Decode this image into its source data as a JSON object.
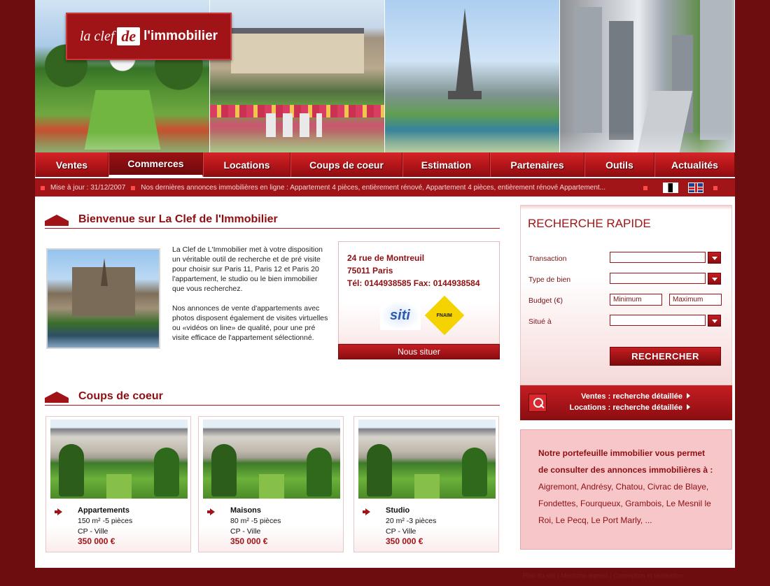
{
  "logo": {
    "la": "la clef",
    "de": "de",
    "imm": "l'immobilier"
  },
  "nav": {
    "items": [
      "Ventes",
      "Commerces",
      "Locations",
      "Coups de coeur",
      "Estimation",
      "Partenaires",
      "Outils",
      "Actualités"
    ],
    "active_index": 1
  },
  "ticker": {
    "update": "Mise à jour : 31/12/2007",
    "news": "Nos dernières annonces immobilières en ligne : Appartement 4 pièces, entièrement rénové, Appartement 4 pièces, entièrement rénové Appartement..."
  },
  "welcome": {
    "title": "Bienvenue sur La Clef de l'Immobilier",
    "para1": "La Clef de L'Immobilier met à votre disposition un véritable outil de recherche et de pré visite pour choisir sur Paris 11, Paris 12 et Paris 20 l'appartement, le studio ou le bien immobilier que vous recherchez.",
    "para2": "Nos annonces de vente d'appartements avec photos disposent également de visites virtuelles ou «vidéos on line» de qualité, pour une pré visite efficace de l'appartement sélectionné."
  },
  "contact": {
    "street": "24 rue de Montreuil",
    "city": "75011 Paris",
    "phone": "Tél: 0144938585  Fax: 0144938584",
    "locate_label": "Nous situer",
    "partner_logos": [
      "siti",
      "FNAIM"
    ]
  },
  "favorites": {
    "title": "Coups de coeur",
    "cards": [
      {
        "type": "Appartements",
        "desc": "150 m² -5 pièces",
        "location": "CP - Ville",
        "price": "350 000 €"
      },
      {
        "type": "Maisons",
        "desc": "80 m² -5 pièces",
        "location": "CP - Ville",
        "price": "350 000 €"
      },
      {
        "type": "Studio",
        "desc": "20 m² -3 pièces",
        "location": "CP - Ville",
        "price": "350 000 €"
      }
    ]
  },
  "search": {
    "title": "RECHERCHE RAPIDE",
    "transaction_label": "Transaction",
    "type_label": "Type de bien",
    "budget_label": "Budget (€)",
    "location_label": "Situé à",
    "min_placeholder": "Minimum",
    "max_placeholder": "Maximum",
    "button_label": "RECHERCHER"
  },
  "detail_links": {
    "ventes": "Ventes : recherche détaillée",
    "locations": "Locations : recherche détaillée"
  },
  "portfolio": {
    "intro": "Notre portefeuille immobilier vous permet de consulter des annonces immobilières à :",
    "cities": "Aigremont, Andrésy, Chatou, Civrac de Blaye, Fondettes, Fourqueux, Grambois, Le Mesnil le Roi, Le Pecq, Le Port Marly, ..."
  },
  "footer": {
    "text": "Plan du site  |  Mentions légales  |  Conception et réalisation"
  },
  "colors": {
    "brand": "#a01417",
    "background": "#6e0d0f",
    "panel_pink": "#f6c6c8"
  }
}
